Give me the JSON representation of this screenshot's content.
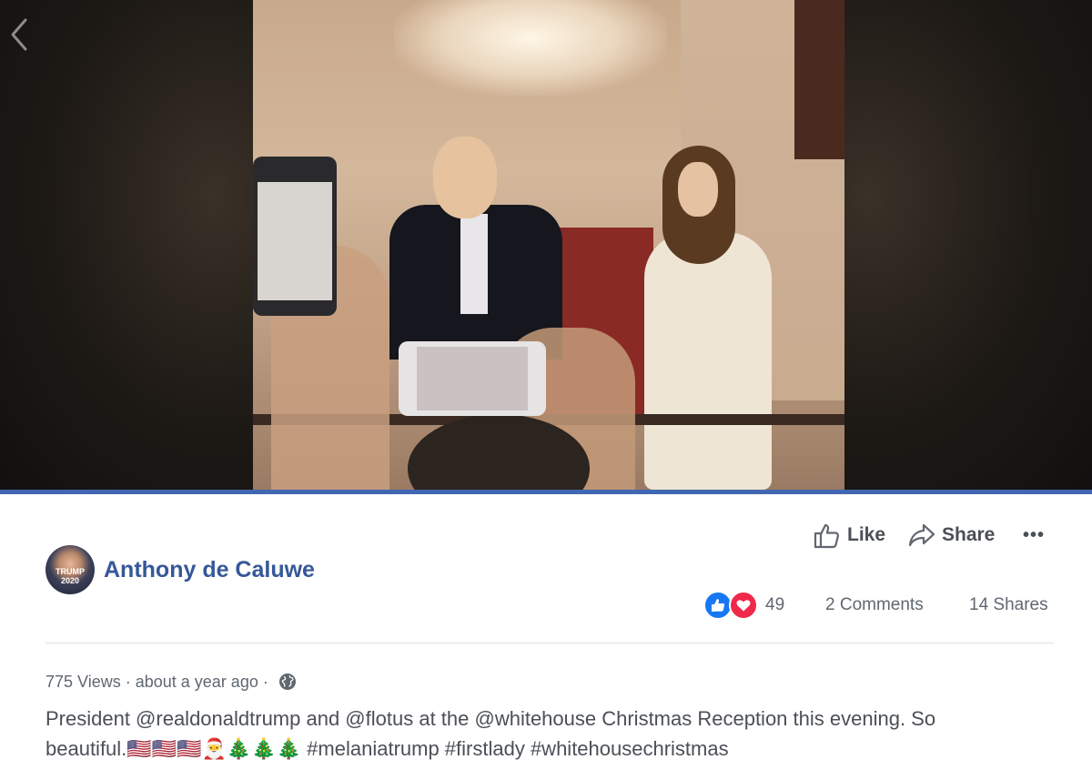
{
  "video": {
    "progress_fraction": 1.0
  },
  "actions": {
    "like_label": "Like",
    "share_label": "Share",
    "more_label": "•••"
  },
  "post": {
    "author_name": "Anthony de Caluwe",
    "avatar_text": "TRUMP 2020",
    "reaction_count": "49",
    "comments_label": "2 Comments",
    "shares_label": "14 Shares",
    "views": "775 Views",
    "separator": " · ",
    "time_label": "about a year ago",
    "caption_line1": "President @realdonaldtrump and @flotus at the @whitehouse Christmas Reception this evening. So",
    "caption_line2_prefix": "beautiful.",
    "caption_emojis": "🇺🇸🇺🇸🇺🇸🎅🎄🎄🎄",
    "caption_hashtags": "#melaniatrump #firstlady #whitehousechristmas"
  },
  "colors": {
    "brand_blue": "#4267b2",
    "author_link": "#365899",
    "text": "#4b4f56",
    "secondary_text": "#606770",
    "like_reaction": "#1877f2",
    "love_reaction": "#f0284a"
  },
  "icons": [
    "back-chevron-icon",
    "thumbs-up-icon",
    "share-arrow-icon",
    "more-dots-icon",
    "like-reaction-icon",
    "love-reaction-icon",
    "globe-icon"
  ]
}
